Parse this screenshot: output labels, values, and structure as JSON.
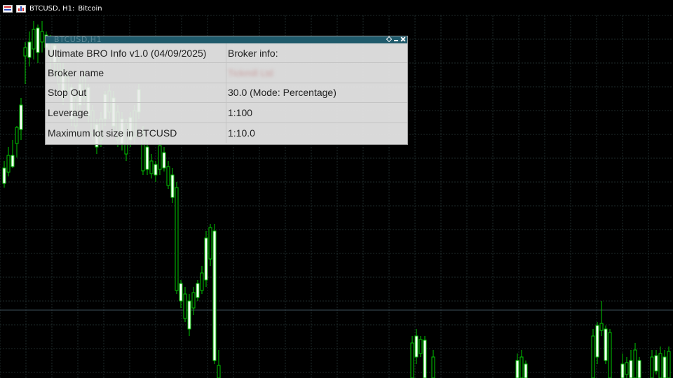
{
  "header": {
    "symbol_label": "BTCUSD, H1:",
    "description": "Bitcoin",
    "icons": [
      "grid-icon",
      "bar-chart-icon"
    ]
  },
  "chart": {
    "background": "#000000",
    "grid_color": "#1e2a2a",
    "bull_color": "#ffffff",
    "wick_color": "#00c800"
  },
  "panel": {
    "ghost_title": "BTCUSD,H1",
    "titlebar_color": "#1f5a6b",
    "rows": [
      {
        "left": "Ultimate BRO Info v1.0 (04/09/2025)",
        "right": "Broker info:"
      },
      {
        "left": "Broker name",
        "right": "Tickmill Ltd"
      },
      {
        "left": "Stop Out",
        "right": "30.0 (Mode: Percentage)"
      },
      {
        "left": "Leverage",
        "right": "1:100"
      },
      {
        "left": "Maximum lot size in BTCUSD",
        "right": "1:10.0"
      }
    ]
  }
}
